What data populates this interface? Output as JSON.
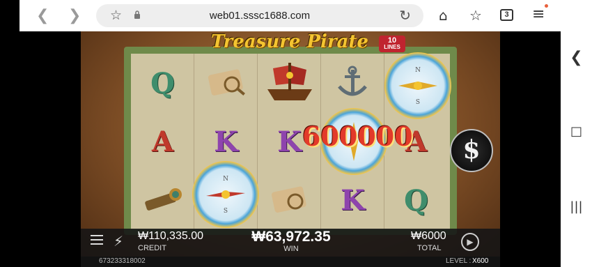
{
  "browser": {
    "url": "web01.sssc1688.com",
    "tab_count": "3",
    "colors": {
      "bar": "#ffffff",
      "url_box": "#eeeeee",
      "notification_dot": "#e8603c"
    },
    "icons": [
      "back-icon",
      "forward-icon",
      "bookmark-star-icon",
      "lock-icon",
      "reload-icon",
      "home-icon",
      "add-bookmark-icon",
      "tabs-icon",
      "menu-icon"
    ]
  },
  "side_panel": {
    "icons": [
      "chevron-left-icon",
      "home-circle-icon",
      "recent-apps-icon"
    ]
  },
  "game": {
    "title": "Treasure Pirate",
    "lines_badge": {
      "number": "10",
      "text": "LINES"
    },
    "win_amount_display": "600000",
    "reels": [
      [
        "Q",
        "A",
        "spyglass"
      ],
      [
        "map",
        "K",
        "compass"
      ],
      [
        "ship",
        "K",
        "map"
      ],
      [
        "anchor",
        "compass",
        "K"
      ],
      [
        "compass",
        "A",
        "Q"
      ]
    ],
    "colors": {
      "Q": "#3f8d6c",
      "A": "#c0392b",
      "K": "#8e44ad",
      "win_text": "#e23a2a",
      "title": "#f4c431"
    },
    "bottom_bar": {
      "credit_value": "₩110,335.00",
      "credit_label": "CREDIT",
      "win_value": "₩63,972.35",
      "win_label": "WIN",
      "total_value": "₩6000",
      "total_label": "TOTAL"
    },
    "footer": {
      "session_id": "673233318002",
      "level_label": "LEVEL :",
      "level_value": "X600"
    }
  }
}
